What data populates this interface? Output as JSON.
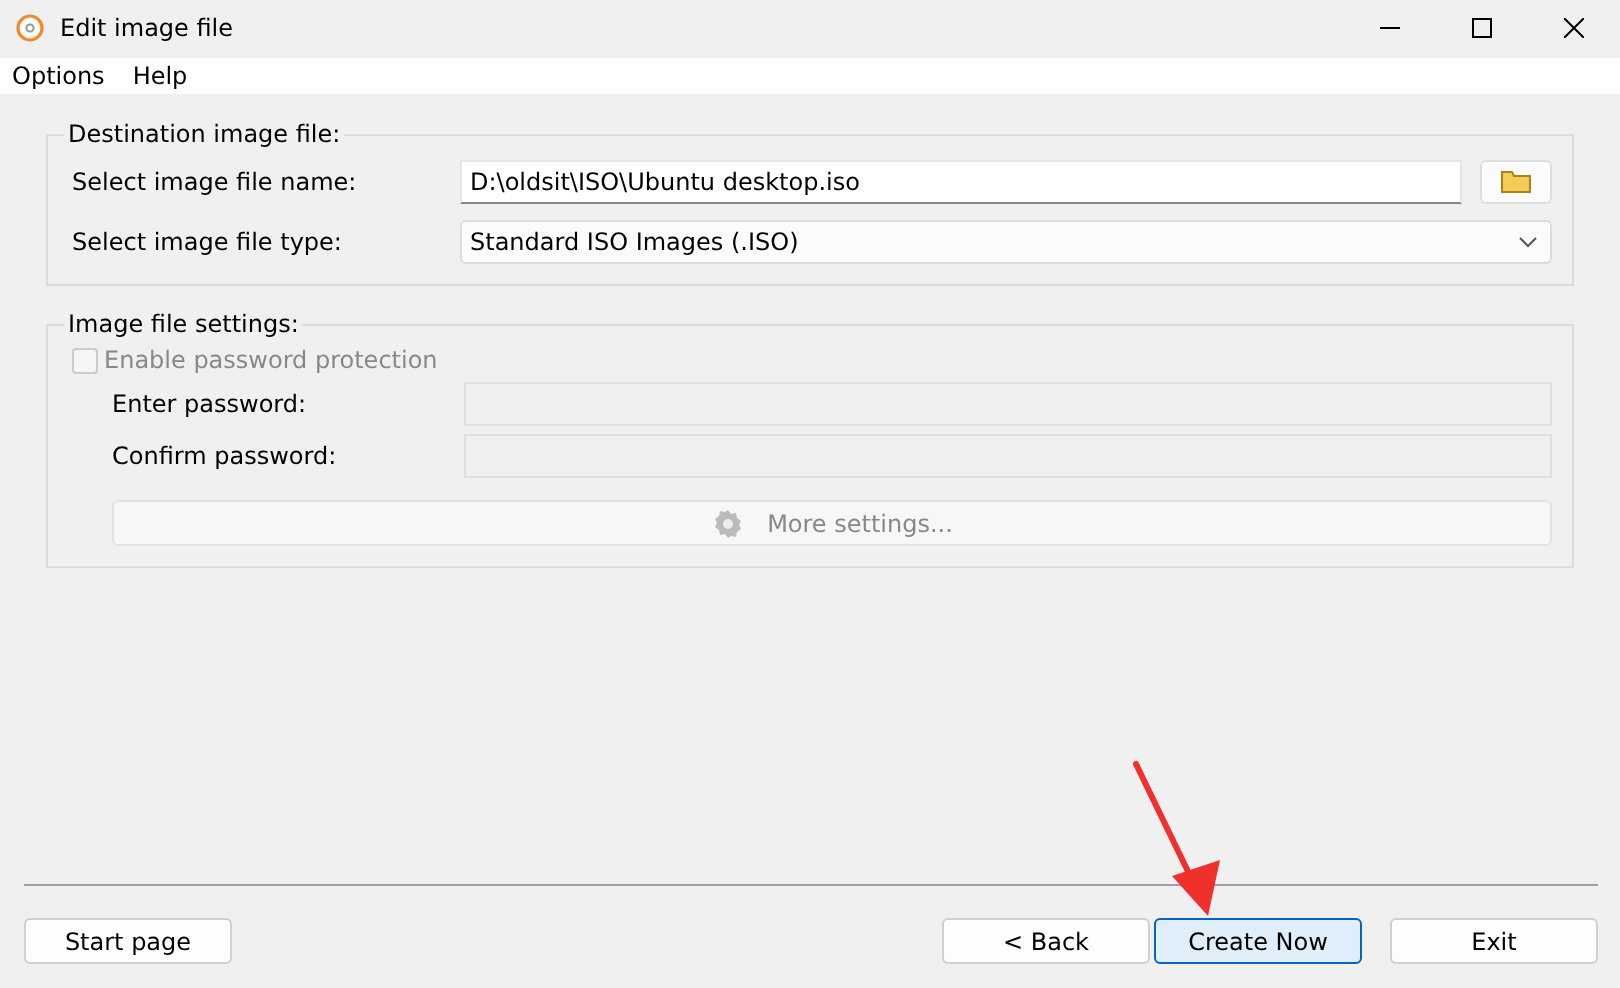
{
  "window": {
    "title": "Edit image file"
  },
  "menu": [
    "Options",
    "Help"
  ],
  "destination": {
    "title": "Destination image file:",
    "name_label": "Select image file name:",
    "name_value": "D:\\oldsit\\ISO\\Ubuntu desktop.iso",
    "type_label": "Select image file type:",
    "type_value": "Standard ISO Images (.ISO)"
  },
  "settings": {
    "title": "Image file settings:",
    "password_protection": {
      "label": "Enable password protection",
      "checked": false,
      "disabled": true
    },
    "fields": [
      {
        "label": "Enter password:",
        "disabled": true
      },
      {
        "label": "Confirm password:",
        "disabled": true
      }
    ],
    "more_button": {
      "label": "More settings...",
      "disabled": true
    }
  },
  "footer": {
    "left": [
      {
        "label": "Start page",
        "focused": false
      }
    ],
    "right": [
      {
        "label": "< Back",
        "focused": false
      },
      {
        "label": "Create Now",
        "focused": true
      },
      {
        "label": "Exit",
        "focused": false
      }
    ]
  }
}
